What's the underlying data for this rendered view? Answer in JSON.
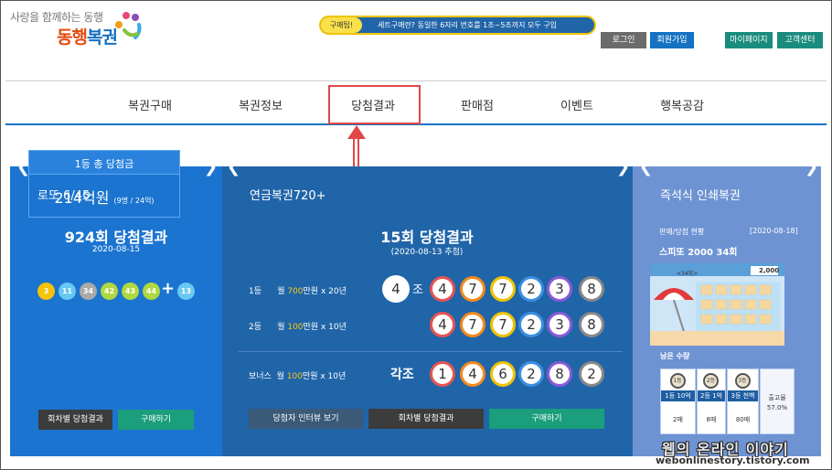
{
  "header": {
    "tagline": "사랑을 함께하는 동행",
    "logo_part1": "동행",
    "logo_part2": "복권",
    "buttons": {
      "login": "로그인",
      "join": "회원가입",
      "mypage": "마이페이지",
      "support": "고객센터"
    }
  },
  "nav": {
    "items": [
      "복권구매",
      "복권정보",
      "당첨결과",
      "판매점",
      "이벤트",
      "행복공감"
    ]
  },
  "lotto": {
    "title": "로또 6/45",
    "round_title": "924회 당첨결과",
    "date": "2020-08-15",
    "balls": [
      {
        "n": "3",
        "color": "#f4c30a"
      },
      {
        "n": "11",
        "color": "#69c8f2"
      },
      {
        "n": "34",
        "color": "#aaaaaa"
      },
      {
        "n": "42",
        "color": "#b0d840"
      },
      {
        "n": "43",
        "color": "#b0d840"
      },
      {
        "n": "44",
        "color": "#b0d840"
      }
    ],
    "plus": "+",
    "bonus": {
      "n": "13",
      "color": "#69c8f2"
    },
    "prize_label": "1등 총 당첨금",
    "prize_amount": "214억원",
    "prize_detail": "(9명 / 24억)",
    "btn_history": "회차별 당첨결과",
    "btn_buy": "구매하기"
  },
  "pension": {
    "title": "연금복권720+",
    "badge": "구매팁!",
    "tip": "세트구매란? 동일한 6자리 번호를 1조~5조까지 모두 구입",
    "round_title": "15회 당첨결과",
    "date": "(2020-08-13 추첨)",
    "rank1_label": "1등",
    "rank1_prefix": "월 ",
    "rank1_amount": "700",
    "rank1_suffix": "만원 x 20년",
    "rank1_group": "4",
    "group_suffix": "조",
    "rank1_digits": [
      "4",
      "7",
      "7",
      "2",
      "3",
      "8"
    ],
    "rank2_label": "2등",
    "rank2_prefix": "월 ",
    "rank2_amount": "100",
    "rank2_suffix": "만원 x 10년",
    "rank2_digits": [
      "4",
      "7",
      "7",
      "2",
      "3",
      "8"
    ],
    "bonus_label": "보너스",
    "bonus_prefix": "월 ",
    "bonus_amount": "100",
    "bonus_suffix": "만원 x 10년",
    "bonus_group": "각조",
    "bonus_digits": [
      "1",
      "4",
      "6",
      "2",
      "8",
      "2"
    ],
    "digit_colors": [
      "#e55353",
      "#f28a1e",
      "#f0c300",
      "#3a8fe0",
      "#8a5bd6",
      "#888888"
    ],
    "btn_interview": "당첨자 인터뷰 보기",
    "btn_history": "회차별 당첨결과",
    "btn_buy": "구매하기"
  },
  "instant": {
    "title": "즉석식 인쇄복권",
    "status_label": "판매/당첨 현황",
    "status_date": "[2020-08-18]",
    "game_name": "스피또 2000 34회",
    "ticket_round": "<34회>",
    "ticket_prize": "2,000",
    "remaining_label": "남은 수량",
    "stats": [
      {
        "medal": "1등",
        "label": "1등 10억",
        "value": "2매"
      },
      {
        "medal": "2등",
        "label": "2등 1억",
        "value": "8매"
      },
      {
        "medal": "3등",
        "label": "3등 천백",
        "value": "80매"
      }
    ],
    "rate_label": "출고율",
    "rate_value": "57.0%"
  },
  "watermark": {
    "ko": "웹의 온라인 이야기",
    "en": "webonlinestory.tistory.com"
  }
}
